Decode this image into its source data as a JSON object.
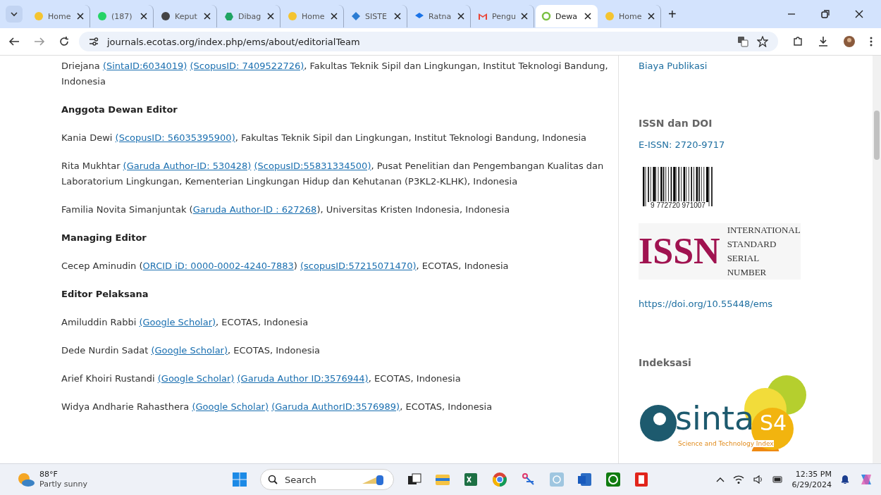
{
  "browser": {
    "tabs": [
      {
        "title": "Home",
        "selected": false
      },
      {
        "title": "(187)",
        "selected": false
      },
      {
        "title": "Keput",
        "selected": false
      },
      {
        "title": "Dibag",
        "selected": false
      },
      {
        "title": "Home",
        "selected": false
      },
      {
        "title": "SISTE",
        "selected": false
      },
      {
        "title": "Ratna",
        "selected": false
      },
      {
        "title": "Pengu",
        "selected": false
      },
      {
        "title": "Dewa",
        "selected": true
      },
      {
        "title": "Home",
        "selected": false
      }
    ],
    "new_tab": "+",
    "url": "journals.ecotas.org/index.php/ems/about/editorialTeam"
  },
  "content": [
    {
      "kind": "para",
      "parts": [
        {
          "kind": "text",
          "text": "Driejana "
        },
        {
          "kind": "link",
          "text": "(SintaID:6034019)"
        },
        {
          "kind": "link",
          "text": "(ScopusID: 7409522726)"
        },
        {
          "kind": "text",
          "text": ", Fakultas Teknik Sipil dan Lingkungan, Institut Teknologi Bandung, Indonesia"
        }
      ]
    },
    {
      "kind": "heading",
      "text": "Anggota Dewan Editor"
    },
    {
      "kind": "para",
      "parts": [
        {
          "kind": "text",
          "text": "Kania Dewi "
        },
        {
          "kind": "link",
          "text": "(ScopusID: 56035395900)"
        },
        {
          "kind": "text",
          "text": ", Fakultas Teknik Sipil dan Lingkungan, Institut Teknologi Bandung, Indonesia"
        }
      ]
    },
    {
      "kind": "para",
      "parts": [
        {
          "kind": "text",
          "text": "Rita Mukhtar "
        },
        {
          "kind": "link",
          "text": "(Garuda Author-ID: 530428)"
        },
        {
          "kind": "link",
          "text": "(ScopusID:55831334500)"
        },
        {
          "kind": "text",
          "text": ", Pusat Penelitian dan Pengembangan Kualitas dan Laboratorium Lingkungan, Kementerian Lingkungan Hidup dan Kehutanan (P3KL2-KLHK), Indonesia"
        }
      ]
    },
    {
      "kind": "para",
      "parts": [
        {
          "kind": "text",
          "text": "Familia Novita Simanjuntak ("
        },
        {
          "kind": "link",
          "text": "Garuda Author-ID : 627268"
        },
        {
          "kind": "text",
          "text": "), Universitas Kristen Indonesia, Indonesia"
        }
      ]
    },
    {
      "kind": "heading",
      "text": "Managing Editor"
    },
    {
      "kind": "para",
      "parts": [
        {
          "kind": "text",
          "text": "Cecep Aminudin ("
        },
        {
          "kind": "link",
          "text": "ORCID iD: 0000-0002-4240-7883"
        },
        {
          "kind": "text",
          "text": ") "
        },
        {
          "kind": "link",
          "text": "(scopusID:57215071470)"
        },
        {
          "kind": "text",
          "text": ", ECOTAS, Indonesia"
        }
      ]
    },
    {
      "kind": "heading",
      "text": "Editor Pelaksana"
    },
    {
      "kind": "para",
      "parts": [
        {
          "kind": "text",
          "text": "Amiluddin Rabbi "
        },
        {
          "kind": "link",
          "text": "(Google Scholar)"
        },
        {
          "kind": "text",
          "text": ", ECOTAS, Indonesia"
        }
      ]
    },
    {
      "kind": "para",
      "parts": [
        {
          "kind": "text",
          "text": "Dede Nurdin Sadat "
        },
        {
          "kind": "link",
          "text": "(Google Scholar)"
        },
        {
          "kind": "text",
          "text": ", ECOTAS, Indonesia"
        }
      ]
    },
    {
      "kind": "para",
      "parts": [
        {
          "kind": "text",
          "text": "Arief Khoiri Rustandi "
        },
        {
          "kind": "link",
          "text": "(Google Scholar)"
        },
        {
          "kind": "link",
          "text": "(Garuda Author ID:3576944)"
        },
        {
          "kind": "text",
          "text": ", ECOTAS, Indonesia"
        }
      ]
    },
    {
      "kind": "para",
      "parts": [
        {
          "kind": "text",
          "text": "Widya Andharie Rahasthera "
        },
        {
          "kind": "link",
          "text": "(Google Scholar)"
        },
        {
          "kind": "link",
          "text": "(Garuda AuthorID:3576989)"
        },
        {
          "kind": "text",
          "text": ", ECOTAS, Indonesia"
        }
      ]
    }
  ],
  "sidebar": {
    "fee_link": "Biaya Publikasi",
    "issn_heading": "ISSN dan DOI",
    "eissn_link": "E-ISSN: 2720-9717",
    "barcode_digits": "9 772720 971007",
    "issn_logo": {
      "mark": "ISSN",
      "lines": [
        "INTERNATIONAL",
        "STANDARD",
        "SERIAL",
        "NUMBER"
      ]
    },
    "doi_link": "https://doi.org/10.55448/ems",
    "index_heading": "Indeksasi",
    "sinta_logo": {
      "word": "sinta",
      "tagline": "Science and Technology Index",
      "rank": "S4"
    }
  },
  "taskbar": {
    "temperature": "88°F",
    "weather": "Partly sunny",
    "search": "Search",
    "time": "12:35 PM",
    "date": "6/29/2024"
  }
}
